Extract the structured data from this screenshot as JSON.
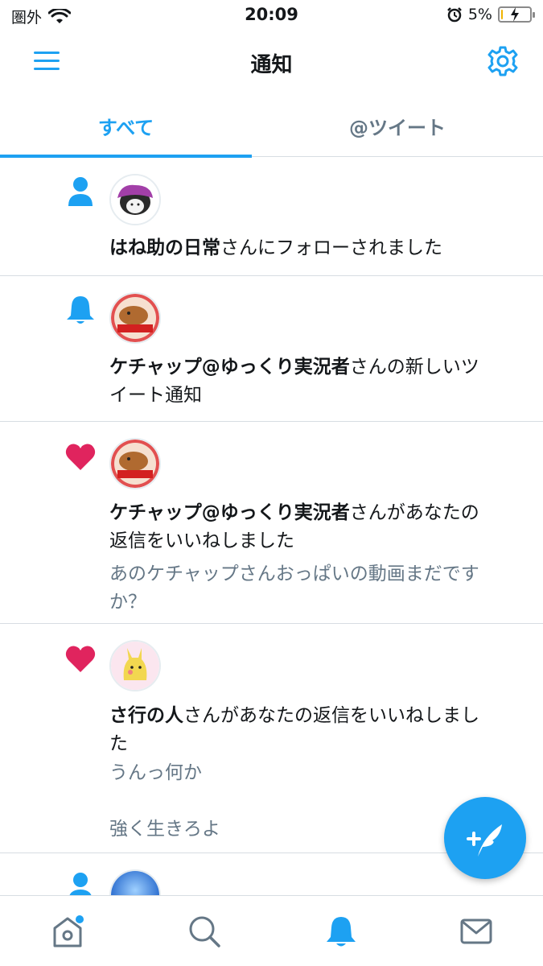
{
  "status_bar": {
    "carrier": "圏外",
    "time": "20:09",
    "battery_percent": "5%",
    "battery_level": 0.05
  },
  "header": {
    "title": "通知",
    "menu_icon": "hamburger-menu-icon",
    "settings_icon": "gear-icon"
  },
  "tabs": [
    {
      "label": "すべて",
      "active": true
    },
    {
      "label": "@ツイート",
      "active": false
    }
  ],
  "notifications": [
    {
      "type": "follow",
      "icon": "person-icon",
      "user": "はね助の日常",
      "action": "さんにフォローされました",
      "quotes": []
    },
    {
      "type": "tweet-notification",
      "icon": "bell-icon",
      "user": "ケチャップ@ゆっくり実況者",
      "action_line1": "さんの新しいツ",
      "action_line2": "イート通知",
      "quotes": []
    },
    {
      "type": "like",
      "icon": "heart-icon",
      "user": "ケチャップ@ゆっくり実況者",
      "action_line1": "さんがあなたの",
      "action_line2": "返信をいいねしました",
      "quote_line1": "あのケチャップさんおっぱいの動画まだです",
      "quote_line2": "か？"
    },
    {
      "type": "like",
      "icon": "heart-icon",
      "user": "さ行の人",
      "action_line1": "さんがあなたの返信をいいねしまし",
      "action_line2": "た",
      "quote_line1": "うんっ何か",
      "quote_line2": "強く生きろよ"
    },
    {
      "type": "follow",
      "icon": "person-icon",
      "user": "",
      "action": ""
    }
  ],
  "fab": {
    "icon": "compose-tweet-icon"
  },
  "bottom_nav": [
    {
      "name": "home",
      "icon": "home-icon",
      "has_badge": true
    },
    {
      "name": "search",
      "icon": "search-icon"
    },
    {
      "name": "notifications",
      "icon": "bell-icon",
      "active": true
    },
    {
      "name": "messages",
      "icon": "mail-icon"
    }
  ],
  "colors": {
    "accent": "#1da1f2",
    "like": "#e0245e",
    "text": "#14171a",
    "secondary_text": "#657786",
    "divider": "#d7dde2"
  }
}
